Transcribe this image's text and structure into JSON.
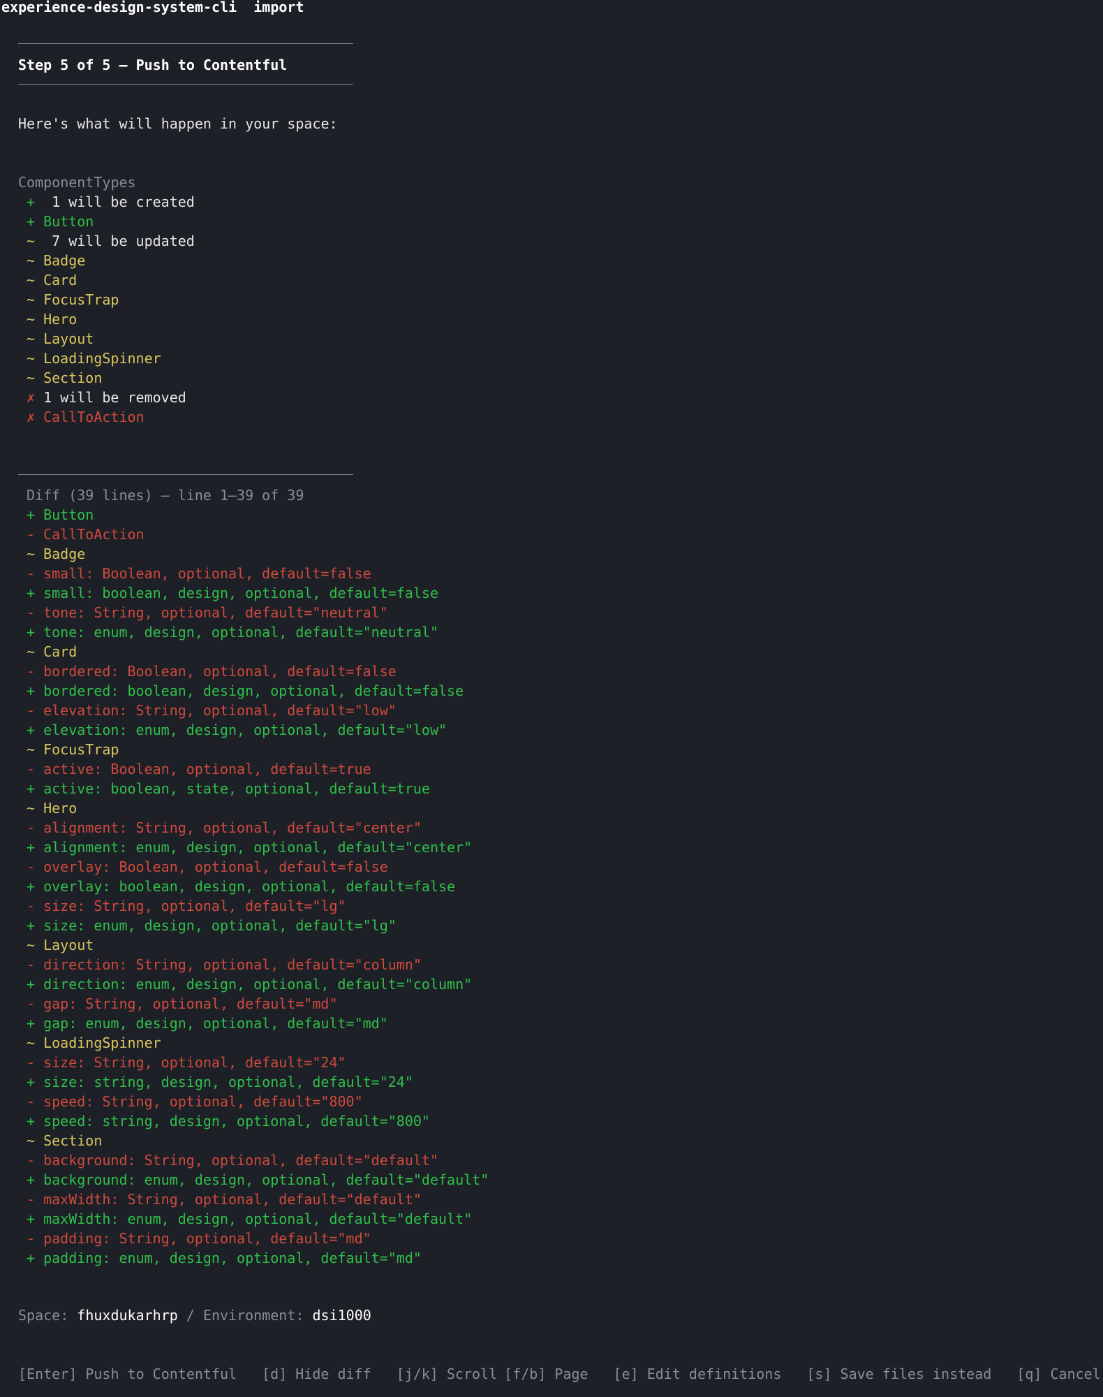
{
  "app": {
    "command": "experience-design-system-cli",
    "subcommand": "import"
  },
  "step": {
    "title": "Step 5 of 5 — Push to Contentful"
  },
  "intro": "Here's what will happen in your space:",
  "summary": {
    "section_title": "ComponentTypes",
    "rows": [
      {
        "kind": "header",
        "symbol": "+",
        "text": "1 will be created",
        "color": "white",
        "symbol_color": "green"
      },
      {
        "kind": "item",
        "symbol": "+",
        "text": "Button",
        "color": "green",
        "symbol_color": "green"
      },
      {
        "kind": "header",
        "symbol": "~",
        "text": "7 will be updated",
        "color": "white",
        "symbol_color": "yellow"
      },
      {
        "kind": "item",
        "symbol": "~",
        "text": "Badge",
        "color": "yellow",
        "symbol_color": "yellow"
      },
      {
        "kind": "item",
        "symbol": "~",
        "text": "Card",
        "color": "yellow",
        "symbol_color": "yellow"
      },
      {
        "kind": "item",
        "symbol": "~",
        "text": "FocusTrap",
        "color": "yellow",
        "symbol_color": "yellow"
      },
      {
        "kind": "item",
        "symbol": "~",
        "text": "Hero",
        "color": "yellow",
        "symbol_color": "yellow"
      },
      {
        "kind": "item",
        "symbol": "~",
        "text": "Layout",
        "color": "yellow",
        "symbol_color": "yellow"
      },
      {
        "kind": "item",
        "symbol": "~",
        "text": "LoadingSpinner",
        "color": "yellow",
        "symbol_color": "yellow"
      },
      {
        "kind": "item",
        "symbol": "~",
        "text": "Section",
        "color": "yellow",
        "symbol_color": "yellow"
      },
      {
        "kind": "header",
        "symbol": "✗",
        "text": "1 will be removed",
        "color": "white",
        "symbol_color": "red"
      },
      {
        "kind": "item",
        "symbol": "✗",
        "text": "CallToAction",
        "color": "red",
        "symbol_color": "red"
      }
    ]
  },
  "diff": {
    "header": "Diff (39 lines) — line 1–39 of 39",
    "lines": [
      {
        "text": "+ Button",
        "color": "green"
      },
      {
        "text": "- CallToAction",
        "color": "red"
      },
      {
        "text": "~ Badge",
        "color": "yellow"
      },
      {
        "text": "- small: Boolean, optional, default=false",
        "color": "red"
      },
      {
        "text": "+ small: boolean, design, optional, default=false",
        "color": "green"
      },
      {
        "text": "- tone: String, optional, default=\"neutral\"",
        "color": "red"
      },
      {
        "text": "+ tone: enum, design, optional, default=\"neutral\"",
        "color": "green"
      },
      {
        "text": "~ Card",
        "color": "yellow"
      },
      {
        "text": "- bordered: Boolean, optional, default=false",
        "color": "red"
      },
      {
        "text": "+ bordered: boolean, design, optional, default=false",
        "color": "green"
      },
      {
        "text": "- elevation: String, optional, default=\"low\"",
        "color": "red"
      },
      {
        "text": "+ elevation: enum, design, optional, default=\"low\"",
        "color": "green"
      },
      {
        "text": "~ FocusTrap",
        "color": "yellow"
      },
      {
        "text": "- active: Boolean, optional, default=true",
        "color": "red"
      },
      {
        "text": "+ active: boolean, state, optional, default=true",
        "color": "green"
      },
      {
        "text": "~ Hero",
        "color": "yellow"
      },
      {
        "text": "- alignment: String, optional, default=\"center\"",
        "color": "red"
      },
      {
        "text": "+ alignment: enum, design, optional, default=\"center\"",
        "color": "green"
      },
      {
        "text": "- overlay: Boolean, optional, default=false",
        "color": "red"
      },
      {
        "text": "+ overlay: boolean, design, optional, default=false",
        "color": "green"
      },
      {
        "text": "- size: String, optional, default=\"lg\"",
        "color": "red"
      },
      {
        "text": "+ size: enum, design, optional, default=\"lg\"",
        "color": "green"
      },
      {
        "text": "~ Layout",
        "color": "yellow"
      },
      {
        "text": "- direction: String, optional, default=\"column\"",
        "color": "red"
      },
      {
        "text": "+ direction: enum, design, optional, default=\"column\"",
        "color": "green"
      },
      {
        "text": "- gap: String, optional, default=\"md\"",
        "color": "red"
      },
      {
        "text": "+ gap: enum, design, optional, default=\"md\"",
        "color": "green"
      },
      {
        "text": "~ LoadingSpinner",
        "color": "yellow"
      },
      {
        "text": "- size: String, optional, default=\"24\"",
        "color": "red"
      },
      {
        "text": "+ size: string, design, optional, default=\"24\"",
        "color": "green"
      },
      {
        "text": "- speed: String, optional, default=\"800\"",
        "color": "red"
      },
      {
        "text": "+ speed: string, design, optional, default=\"800\"",
        "color": "green"
      },
      {
        "text": "~ Section",
        "color": "yellow"
      },
      {
        "text": "- background: String, optional, default=\"default\"",
        "color": "red"
      },
      {
        "text": "+ background: enum, design, optional, default=\"default\"",
        "color": "green"
      },
      {
        "text": "- maxWidth: String, optional, default=\"default\"",
        "color": "red"
      },
      {
        "text": "+ maxWidth: enum, design, optional, default=\"default\"",
        "color": "green"
      },
      {
        "text": "- padding: String, optional, default=\"md\"",
        "color": "red"
      },
      {
        "text": "+ padding: enum, design, optional, default=\"md\"",
        "color": "green"
      }
    ]
  },
  "target": {
    "space_label": "Space:",
    "space_value": "fhuxdukarhrp",
    "separator": "/",
    "environment_label": "Environment:",
    "environment_value": "dsi1000"
  },
  "keybindings": [
    {
      "label": "[Enter] Push to Contentful"
    },
    {
      "label": "[d] Hide diff"
    },
    {
      "label": "[j/k] Scroll"
    },
    {
      "label": "[f/b] Page"
    },
    {
      "label": "[e] Edit definitions"
    },
    {
      "label": "[s] Save files instead"
    },
    {
      "label": "[q] Cancel"
    }
  ],
  "colors": {
    "background": "#1e2027",
    "green": "#2fbf4a",
    "yellow": "#d9c75f",
    "red": "#cf4a3d",
    "muted": "#8b8d94",
    "text": "#e6e6e6"
  }
}
